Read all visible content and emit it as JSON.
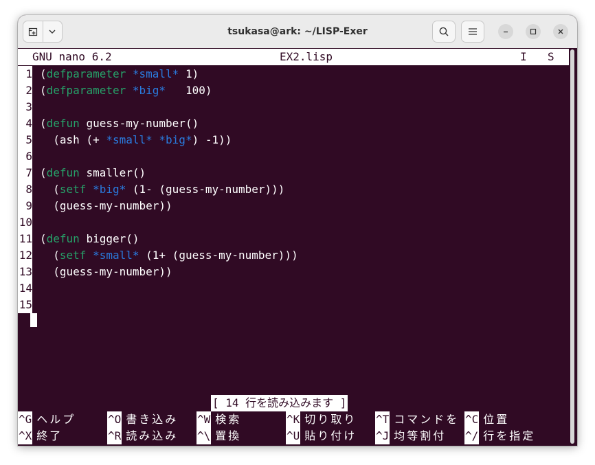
{
  "window": {
    "title": "tsukasa@ark: ~/LISP-Exer"
  },
  "icons": {
    "new_tab": "new-tab-icon",
    "menu_dropdown": "chevron-down-icon",
    "search": "search-icon",
    "hamburger": "hamburger-menu-icon",
    "minimize": "minimize-icon",
    "maximize": "maximize-icon",
    "close": "close-icon"
  },
  "nano": {
    "version": "GNU nano 6.2",
    "filename": "EX2.lisp",
    "flags": [
      "I",
      "S"
    ],
    "status": "[ 14 行を読み込みます ]"
  },
  "code_lines": [
    {
      "n": "1",
      "tokens": [
        {
          "t": "("
        },
        {
          "t": "defparameter",
          "c": "kw"
        },
        {
          "t": " "
        },
        {
          "t": "*small*",
          "c": "var"
        },
        {
          "t": " 1)"
        }
      ]
    },
    {
      "n": "2",
      "tokens": [
        {
          "t": "("
        },
        {
          "t": "defparameter",
          "c": "kw"
        },
        {
          "t": " "
        },
        {
          "t": "*big*",
          "c": "var"
        },
        {
          "t": "   100)"
        }
      ]
    },
    {
      "n": "3",
      "tokens": []
    },
    {
      "n": "4",
      "tokens": [
        {
          "t": "("
        },
        {
          "t": "defun",
          "c": "kw"
        },
        {
          "t": " guess-my-number()"
        }
      ]
    },
    {
      "n": "5",
      "tokens": [
        {
          "t": "  (ash (+ "
        },
        {
          "t": "*small*",
          "c": "var"
        },
        {
          "t": " "
        },
        {
          "t": "*big*",
          "c": "var"
        },
        {
          "t": ") -1))"
        }
      ]
    },
    {
      "n": "6",
      "tokens": []
    },
    {
      "n": "7",
      "tokens": [
        {
          "t": "("
        },
        {
          "t": "defun",
          "c": "kw"
        },
        {
          "t": " smaller()"
        }
      ]
    },
    {
      "n": "8",
      "tokens": [
        {
          "t": "  ("
        },
        {
          "t": "setf",
          "c": "kw"
        },
        {
          "t": " "
        },
        {
          "t": "*big*",
          "c": "var"
        },
        {
          "t": " (1- (guess-my-number)))"
        }
      ]
    },
    {
      "n": "9",
      "tokens": [
        {
          "t": "  (guess-my-number))"
        }
      ]
    },
    {
      "n": "10",
      "tokens": []
    },
    {
      "n": "11",
      "tokens": [
        {
          "t": "("
        },
        {
          "t": "defun",
          "c": "kw"
        },
        {
          "t": " bigger()"
        }
      ]
    },
    {
      "n": "12",
      "tokens": [
        {
          "t": "  ("
        },
        {
          "t": "setf",
          "c": "kw"
        },
        {
          "t": " "
        },
        {
          "t": "*small*",
          "c": "var"
        },
        {
          "t": " (1+ (guess-my-number)))"
        }
      ]
    },
    {
      "n": "13",
      "tokens": [
        {
          "t": "  (guess-my-number))"
        }
      ]
    },
    {
      "n": "14",
      "tokens": []
    },
    {
      "n": "15",
      "tokens": []
    }
  ],
  "shortcuts": [
    [
      {
        "key": "^G",
        "label": "ヘルプ"
      },
      {
        "key": "^O",
        "label": "書き込み"
      },
      {
        "key": "^W",
        "label": "検索"
      },
      {
        "key": "^K",
        "label": "切り取り"
      },
      {
        "key": "^T",
        "label": "コマンドを"
      },
      {
        "key": "^C",
        "label": "位置"
      }
    ],
    [
      {
        "key": "^X",
        "label": "終了"
      },
      {
        "key": "^R",
        "label": "読み込み"
      },
      {
        "key": "^\\",
        "label": "置換"
      },
      {
        "key": "^U",
        "label": "貼り付け"
      },
      {
        "key": "^J",
        "label": "均等割付"
      },
      {
        "key": "^/",
        "label": "行を指定"
      }
    ]
  ],
  "colors": {
    "terminal_bg": "#300a24",
    "keyword": "#26a269",
    "variable": "#2a7bde",
    "foreground": "#ffffff"
  }
}
